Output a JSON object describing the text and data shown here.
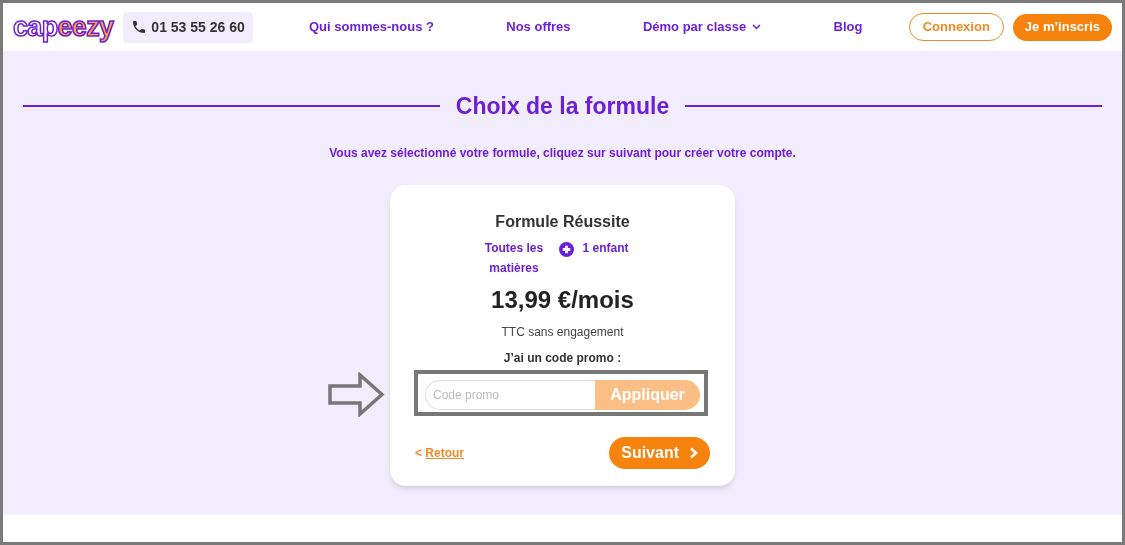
{
  "logo": {
    "part_1": "cap",
    "part_2": "eezy"
  },
  "phone": "01 53 55 26 60",
  "nav": [
    {
      "label": "Qui sommes-nous ?",
      "dropdown": false
    },
    {
      "label": "Nos offres",
      "dropdown": false
    },
    {
      "label": "Démo par classe",
      "dropdown": true
    },
    {
      "label": "Blog",
      "dropdown": false
    }
  ],
  "login_button": "Connexion",
  "signup_button": "Je m’inscris",
  "title": "Choix de la formule",
  "subtitle": "Vous avez sélectionné votre formule, cliquez sur suivant pour créer votre compte.",
  "plan": {
    "name": "Formule Réussite",
    "feature_1": "Toutes les matières",
    "feature_2": "1 enfant",
    "price": "13,99 €/mois",
    "note": "TTC sans engagement"
  },
  "promo": {
    "label": "J’ai un code promo :",
    "placeholder": "Code promo",
    "button": "Appliquer"
  },
  "back_link": {
    "icon": "<",
    "label": "Retour"
  },
  "next_button": "Suivant"
}
